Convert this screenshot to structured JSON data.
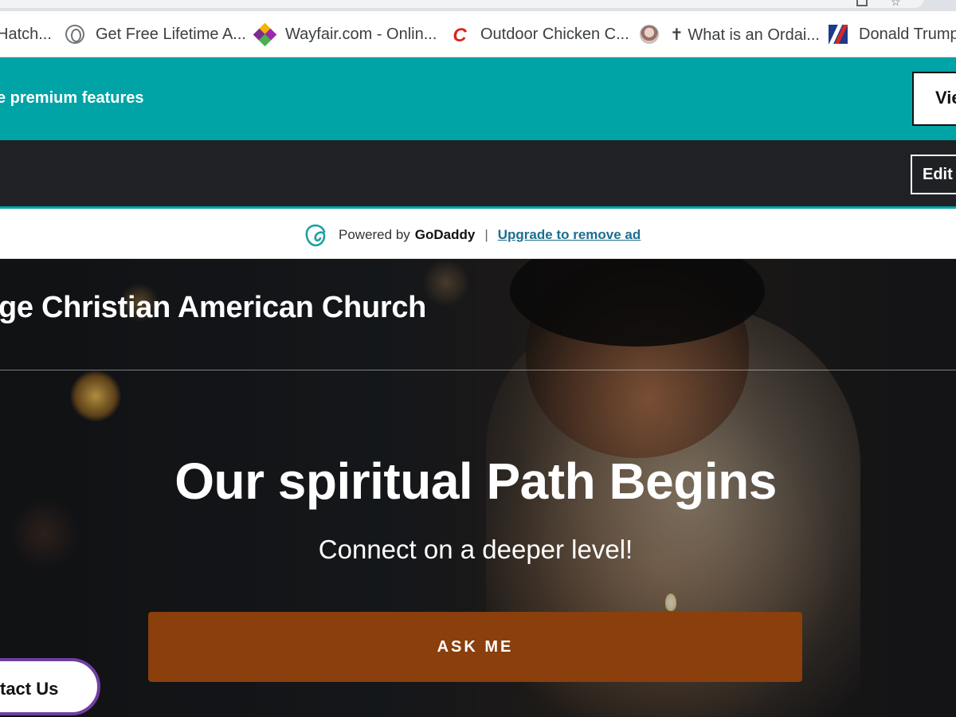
{
  "bookmarks": [
    {
      "label": "Hatch...",
      "icon": "bookmark-favicon"
    },
    {
      "label": "Get Free Lifetime A...",
      "icon": "globe-icon"
    },
    {
      "label": "Wayfair.com - Onlin...",
      "icon": "wayfair-icon"
    },
    {
      "label": "Outdoor Chicken C...",
      "icon": "chicken-coop-icon"
    },
    {
      "label": "✝ What is an Ordai...",
      "icon": "ordained-icon"
    },
    {
      "label": "Donald Trump",
      "icon": "trump-flag-icon"
    }
  ],
  "premium_banner": {
    "text": "e premium features",
    "button_label": "Vie",
    "color": "#00a4a6"
  },
  "editor_bar": {
    "edit_label": "Edit"
  },
  "godaddy": {
    "powered_by": "Powered by",
    "brand": "GoDaddy",
    "separator": "|",
    "upgrade_link": "Upgrade to remove ad"
  },
  "hero": {
    "site_title": "ge Christian American Church",
    "heading": "Our spiritual Path Begins",
    "subheading": "Connect on a deeper level!",
    "cta_label": "ASK ME",
    "cta_color": "#8a3f0c"
  },
  "contact": {
    "label": "tact Us"
  }
}
